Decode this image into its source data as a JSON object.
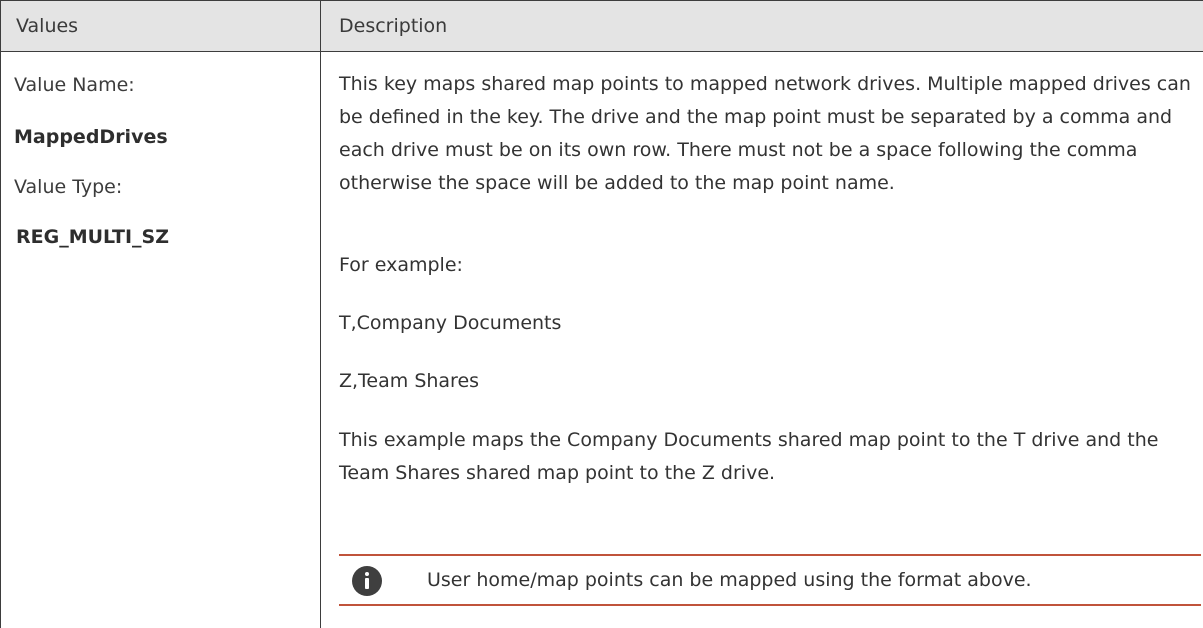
{
  "table": {
    "headers": {
      "values": "Values",
      "description": "Description"
    },
    "values": {
      "value_name_label": "Value Name:",
      "value_name": "MappedDrives",
      "value_type_label": "Value Type:",
      "value_type": "REG_MULTI_SZ"
    },
    "description": {
      "paragraph": "This key maps shared map points to mapped network drives. Multiple mapped drives can be defined in the key. The drive and the map point must be separated by a comma and each drive must be on its own row. There must not be a space following the comma otherwise the space will be added to the map point name.",
      "example_label": "For example:",
      "example_1": "T,Company Documents",
      "example_2": "Z,Team Shares",
      "explanation": "This example maps the Company Documents shared map point to the T drive and the Team Shares shared map point to the Z drive."
    },
    "note": {
      "icon": "info-icon",
      "text": "User home/map points can be mapped using the format above.",
      "accent_color": "#c0533b"
    }
  }
}
